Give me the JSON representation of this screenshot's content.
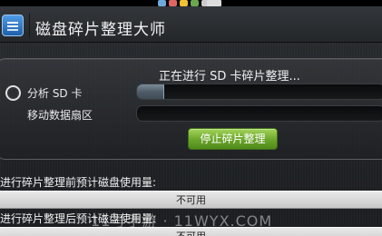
{
  "header": {
    "title": "磁盘碎片整理大师"
  },
  "progress": {
    "status_text": "正在进行 SD 卡碎片整理...",
    "items": [
      {
        "label": "分析 SD 卡",
        "progress": 0.11
      },
      {
        "label": "移动数据扇区",
        "progress": 0
      }
    ],
    "stop_button_label": "停止碎片整理"
  },
  "usage": {
    "before_label": "进行碎片整理前预计磁盘使用量:",
    "before_value": "不可用",
    "after_label": "进行碎片整理后预计磁盘使用量:",
    "after_value": "不可用"
  },
  "watermark": "11号手游 · 11WYX.COM",
  "colors": {
    "accent_green": "#6aa52a",
    "progress_fill": "#5a6873"
  }
}
